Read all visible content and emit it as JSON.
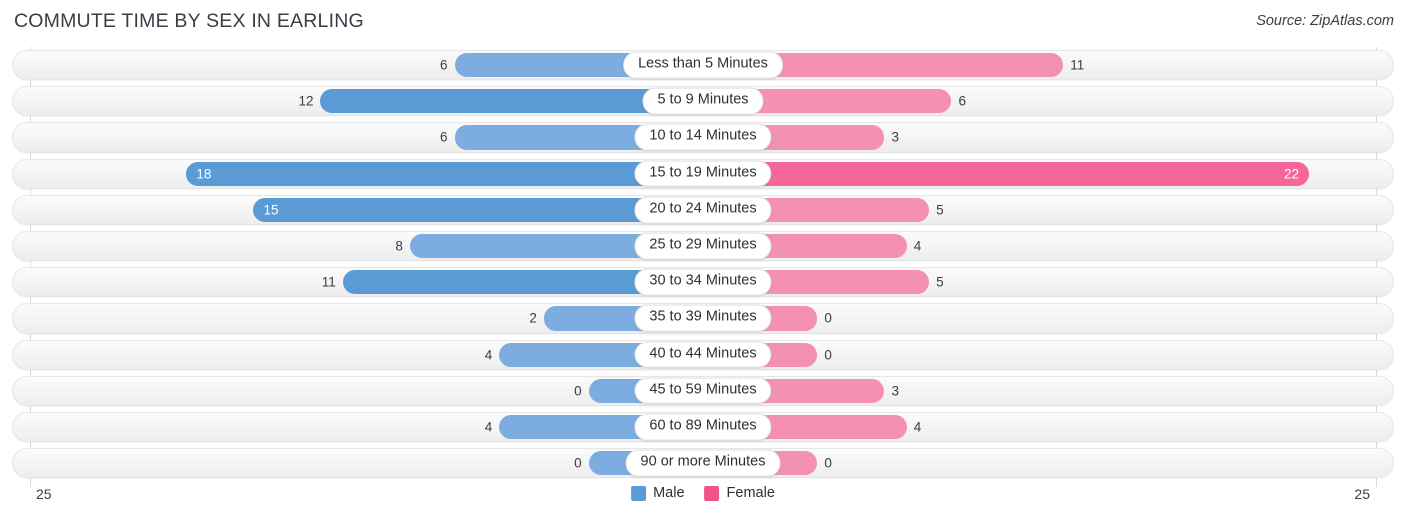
{
  "header": {
    "title": "COMMUTE TIME BY SEX IN EARLING",
    "source": "Source: ZipAtlas.com"
  },
  "axis": {
    "left_end": "25",
    "right_end": "25"
  },
  "legend": {
    "items": [
      {
        "label": "Male",
        "color": "#5B9BD5"
      },
      {
        "label": "Female",
        "color": "#F0548A"
      }
    ]
  },
  "chart_data": {
    "type": "bar",
    "title": "COMMUTE TIME BY SEX IN EARLING",
    "subtitle": "Source: ZipAtlas.com",
    "orientation": "horizontal-diverging",
    "xlabel": "",
    "ylabel": "",
    "xlim": [
      25,
      25
    ],
    "axis_left_max": 25,
    "axis_right_max": 25,
    "grid": true,
    "legend_position": "bottom-center",
    "categories": [
      "Less than 5 Minutes",
      "5 to 9 Minutes",
      "10 to 14 Minutes",
      "15 to 19 Minutes",
      "20 to 24 Minutes",
      "25 to 29 Minutes",
      "30 to 34 Minutes",
      "35 to 39 Minutes",
      "40 to 44 Minutes",
      "45 to 59 Minutes",
      "60 to 89 Minutes",
      "90 or more Minutes"
    ],
    "series": [
      {
        "name": "Male",
        "color": "#7CACE0",
        "highlight_color": "#5B9BD5",
        "values": [
          6,
          12,
          6,
          18,
          15,
          8,
          11,
          2,
          4,
          0,
          4,
          0
        ]
      },
      {
        "name": "Female",
        "color": "#F491B2",
        "highlight_color": "#F5679B",
        "values": [
          11,
          6,
          3,
          22,
          5,
          4,
          5,
          0,
          0,
          3,
          4,
          0
        ]
      }
    ]
  },
  "rows": [
    {
      "label": "Less than 5 Minutes",
      "male": "6",
      "female": "11",
      "male_val": 6,
      "female_val": 11,
      "male_hot": false,
      "female_hot": false,
      "male_inside": false,
      "female_inside": false
    },
    {
      "label": "5 to 9 Minutes",
      "male": "12",
      "female": "6",
      "male_val": 12,
      "female_val": 6,
      "male_hot": true,
      "female_hot": false,
      "male_inside": false,
      "female_inside": false
    },
    {
      "label": "10 to 14 Minutes",
      "male": "6",
      "female": "3",
      "male_val": 6,
      "female_val": 3,
      "male_hot": false,
      "female_hot": false,
      "male_inside": false,
      "female_inside": false
    },
    {
      "label": "15 to 19 Minutes",
      "male": "18",
      "female": "22",
      "male_val": 18,
      "female_val": 22,
      "male_hot": true,
      "female_hot": true,
      "male_inside": true,
      "female_inside": true
    },
    {
      "label": "20 to 24 Minutes",
      "male": "15",
      "female": "5",
      "male_val": 15,
      "female_val": 5,
      "male_hot": true,
      "female_hot": false,
      "male_inside": true,
      "female_inside": false
    },
    {
      "label": "25 to 29 Minutes",
      "male": "8",
      "female": "4",
      "male_val": 8,
      "female_val": 4,
      "male_hot": false,
      "female_hot": false,
      "male_inside": false,
      "female_inside": false
    },
    {
      "label": "30 to 34 Minutes",
      "male": "11",
      "female": "5",
      "male_val": 11,
      "female_val": 5,
      "male_hot": true,
      "female_hot": false,
      "male_inside": false,
      "female_inside": false
    },
    {
      "label": "35 to 39 Minutes",
      "male": "2",
      "female": "0",
      "male_val": 2,
      "female_val": 0,
      "male_hot": false,
      "female_hot": false,
      "male_inside": false,
      "female_inside": false
    },
    {
      "label": "40 to 44 Minutes",
      "male": "4",
      "female": "0",
      "male_val": 4,
      "female_val": 0,
      "male_hot": false,
      "female_hot": false,
      "male_inside": false,
      "female_inside": false
    },
    {
      "label": "45 to 59 Minutes",
      "male": "0",
      "female": "3",
      "male_val": 0,
      "female_val": 3,
      "male_hot": false,
      "female_hot": false,
      "male_inside": false,
      "female_inside": false
    },
    {
      "label": "60 to 89 Minutes",
      "male": "4",
      "female": "4",
      "male_val": 4,
      "female_val": 4,
      "male_hot": false,
      "female_hot": false,
      "male_inside": false,
      "female_inside": false
    },
    {
      "label": "90 or more Minutes",
      "male": "0",
      "female": "0",
      "male_val": 0,
      "female_val": 0,
      "male_hot": false,
      "female_hot": false,
      "male_inside": false,
      "female_inside": false
    }
  ]
}
